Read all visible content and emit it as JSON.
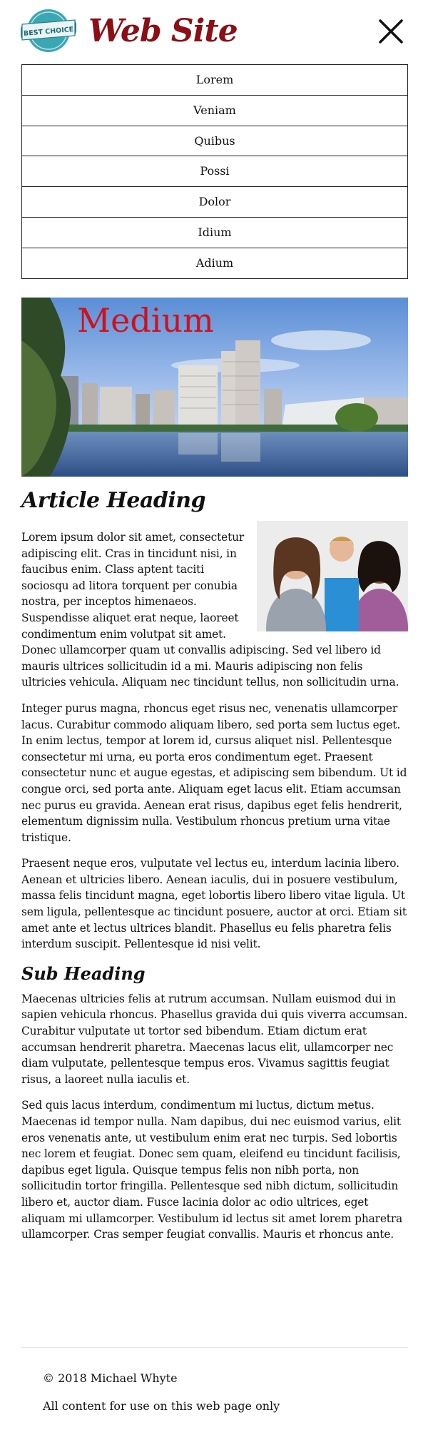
{
  "header": {
    "logo_text": "BEST CHOICE",
    "site_title": "Web Site",
    "close_icon": "close-icon"
  },
  "nav": {
    "items": [
      {
        "label": "Lorem"
      },
      {
        "label": "Veniam"
      },
      {
        "label": "Quibus"
      },
      {
        "label": "Possi"
      },
      {
        "label": "Dolor"
      },
      {
        "label": "Idium"
      },
      {
        "label": "Adium"
      }
    ]
  },
  "hero": {
    "label": "Medium"
  },
  "article": {
    "heading": "Article Heading",
    "paragraphs": [
      "Lorem ipsum dolor sit amet, consectetur adipiscing elit. Cras in tincidunt nisi, in faucibus enim. Class aptent taciti sociosqu ad litora torquent per conubia nostra, per inceptos himenaeos. Suspendisse aliquet erat neque, laoreet condimentum enim volutpat sit amet. Donec ullamcorper quam ut convallis adipiscing. Sed vel libero id mauris ultrices sollicitudin id a mi. Mauris adipiscing non felis ultricies vehicula. Aliquam nec tincidunt tellus, non sollicitudin urna.",
      "Integer purus magna, rhoncus eget risus nec, venenatis ullamcorper lacus. Curabitur commodo aliquam libero, sed porta sem luctus eget. In enim lectus, tempor at lorem id, cursus aliquet nisl. Pellentesque consectetur mi urna, eu porta eros condimentum eget. Praesent consectetur nunc et augue egestas, et adipiscing sem bibendum. Ut id congue orci, sed porta ante. Aliquam eget lacus elit. Etiam accumsan nec purus eu gravida. Aenean erat risus, dapibus eget felis hendrerit, elementum dignissim nulla. Vestibulum rhoncus pretium urna vitae tristique.",
      "Praesent neque eros, vulputate vel lectus eu, interdum lacinia libero. Aenean et ultricies libero. Aenean iaculis, dui in posuere vestibulum, massa felis tincidunt magna, eget lobortis libero libero vitae ligula. Ut sem ligula, pellentesque ac tincidunt posuere, auctor at orci. Etiam sit amet ante et lectus ultrices blandit. Phasellus eu felis pharetra felis interdum suscipit. Pellentesque id nisi velit."
    ],
    "subheading": "Sub Heading",
    "sub_paragraphs": [
      "Maecenas ultricies felis at rutrum accumsan. Nullam euismod dui in sapien vehicula rhoncus. Phasellus gravida dui quis viverra accumsan. Curabitur vulputate ut tortor sed bibendum. Etiam dictum erat accumsan hendrerit pharetra. Maecenas lacus elit, ullamcorper nec diam vulputate, pellentesque tempus eros. Vivamus sagittis feugiat risus, a laoreet nulla iaculis et.",
      "Sed quis lacus interdum, condimentum mi luctus, dictum metus. Maecenas id tempor nulla. Nam dapibus, dui nec euismod varius, elit eros venenatis ante, ut vestibulum enim erat nec turpis. Sed lobortis nec lorem et feugiat. Donec sem quam, eleifend eu tincidunt facilisis, dapibus eget ligula. Quisque tempus felis non nibh porta, non sollicitudin tortor fringilla. Pellentesque sed nibh dictum, sollicitudin libero et, auctor diam. Fusce lacinia dolor ac odio ultrices, eget aliquam mi ullamcorper. Vestibulum id lectus sit amet lorem pharetra ullamcorper. Cras semper feugiat convallis. Mauris et rhoncus ante."
    ]
  },
  "footer": {
    "copyright": "© 2018 Michael Whyte",
    "note": "All content for use on this web page only"
  },
  "colors": {
    "brand": "#8b0f14",
    "hero_label": "#d1101a",
    "logo_teal": "#3aa7b3"
  }
}
